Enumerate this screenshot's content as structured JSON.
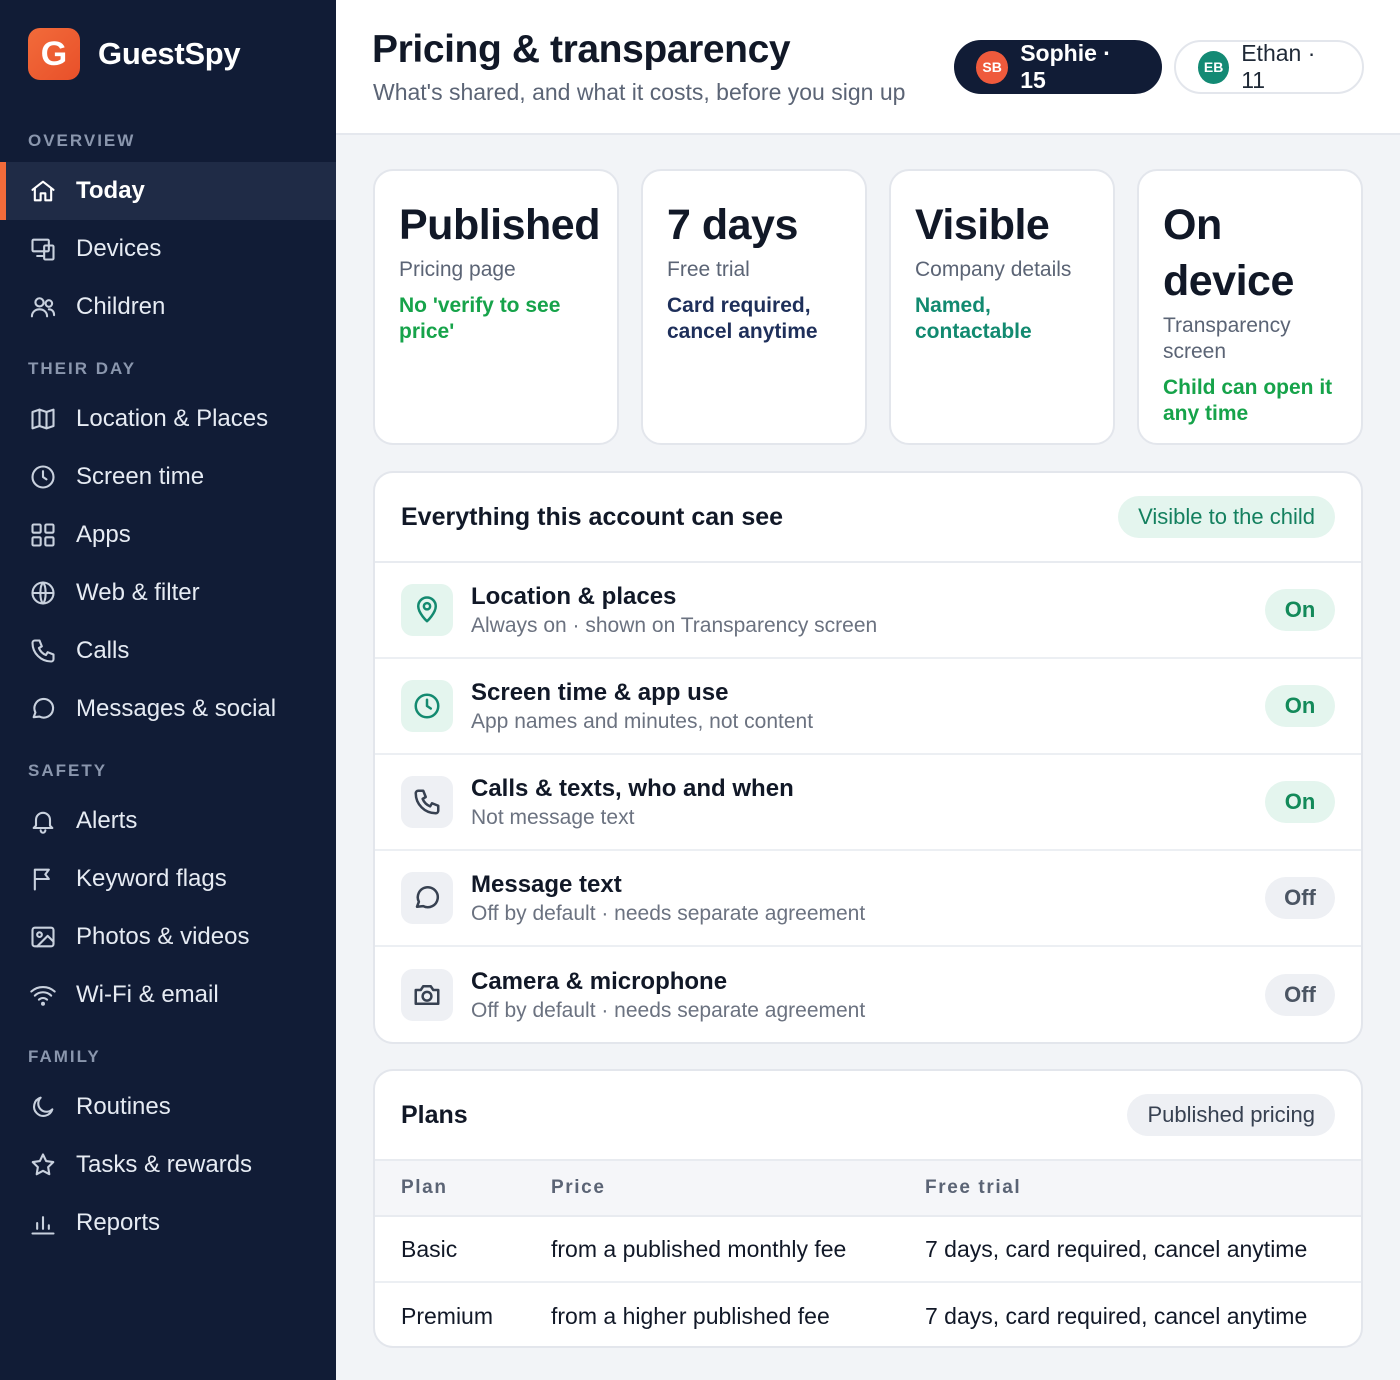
{
  "brand": {
    "logo_letter": "G",
    "name": "GuestSpy"
  },
  "sidebar": {
    "sections": [
      {
        "title": "OVERVIEW",
        "items": [
          {
            "label": "Today",
            "icon": "home-icon",
            "active": true
          },
          {
            "label": "Devices",
            "icon": "devices-icon"
          },
          {
            "label": "Children",
            "icon": "users-icon"
          }
        ]
      },
      {
        "title": "THEIR DAY",
        "items": [
          {
            "label": "Location & Places",
            "icon": "map-icon"
          },
          {
            "label": "Screen time",
            "icon": "clock-icon"
          },
          {
            "label": "Apps",
            "icon": "grid-icon"
          },
          {
            "label": "Web & filter",
            "icon": "globe-icon"
          },
          {
            "label": "Calls",
            "icon": "phone-icon"
          },
          {
            "label": "Messages & social",
            "icon": "message-icon"
          }
        ]
      },
      {
        "title": "SAFETY",
        "items": [
          {
            "label": "Alerts",
            "icon": "bell-icon"
          },
          {
            "label": "Keyword flags",
            "icon": "flag-icon"
          },
          {
            "label": "Photos & videos",
            "icon": "image-icon"
          },
          {
            "label": "Wi-Fi & email",
            "icon": "wifi-icon"
          }
        ]
      },
      {
        "title": "FAMILY",
        "items": [
          {
            "label": "Routines",
            "icon": "moon-icon"
          },
          {
            "label": "Tasks & rewards",
            "icon": "star-icon"
          },
          {
            "label": "Reports",
            "icon": "bar-chart-icon"
          }
        ]
      }
    ]
  },
  "header": {
    "title": "Pricing & transparency",
    "subtitle": "What's shared, and what it costs, before you sign up",
    "children": [
      {
        "initials": "SB",
        "label": "Sophie · 15",
        "selected": true,
        "color": "#ef5a3c"
      },
      {
        "initials": "EB",
        "label": "Ethan · 11",
        "selected": false,
        "color": "#138a74"
      }
    ]
  },
  "stats": [
    {
      "value": "Published",
      "label": "Pricing page",
      "note": "No 'verify to see price'",
      "note_color": "#16a34a"
    },
    {
      "value": "7 days",
      "label": "Free trial",
      "note": "Card required, cancel anytime",
      "note_color": "#1e2f5a"
    },
    {
      "value": "Visible",
      "label": "Company details",
      "note": "Named, contactable",
      "note_color": "#128a70"
    },
    {
      "value": "On device",
      "label": "Transparency screen",
      "note": "Child can open it any time",
      "note_color": "#16a34a"
    }
  ],
  "visibility": {
    "title": "Everything this account can see",
    "tag": "Visible to the child",
    "rows": [
      {
        "icon": "location-pin-icon",
        "title": "Location & places",
        "sub": "Always on · shown on Transparency screen",
        "state": "On"
      },
      {
        "icon": "clock-icon",
        "title": "Screen time & app use",
        "sub": "App names and minutes, not content",
        "state": "On"
      },
      {
        "icon": "phone-icon",
        "title": "Calls & texts, who and when",
        "sub": "Not message text",
        "state": "On"
      },
      {
        "icon": "message-icon",
        "title": "Message text",
        "sub": "Off by default · needs separate agreement",
        "state": "Off"
      },
      {
        "icon": "camera-icon",
        "title": "Camera & microphone",
        "sub": "Off by default · needs separate agreement",
        "state": "Off"
      }
    ]
  },
  "plans": {
    "title": "Plans",
    "tag": "Published pricing",
    "columns": [
      "Plan",
      "Price",
      "Free trial"
    ],
    "rows": [
      [
        "Basic",
        "from a published monthly fee",
        "7 days, card required, cancel anytime"
      ],
      [
        "Premium",
        "from a higher published fee",
        "7 days, card required, cancel anytime"
      ]
    ]
  },
  "colors": {
    "sidebar_bg": "#111c36",
    "accent": "#f26b3a",
    "on_green": "#138a5a"
  }
}
